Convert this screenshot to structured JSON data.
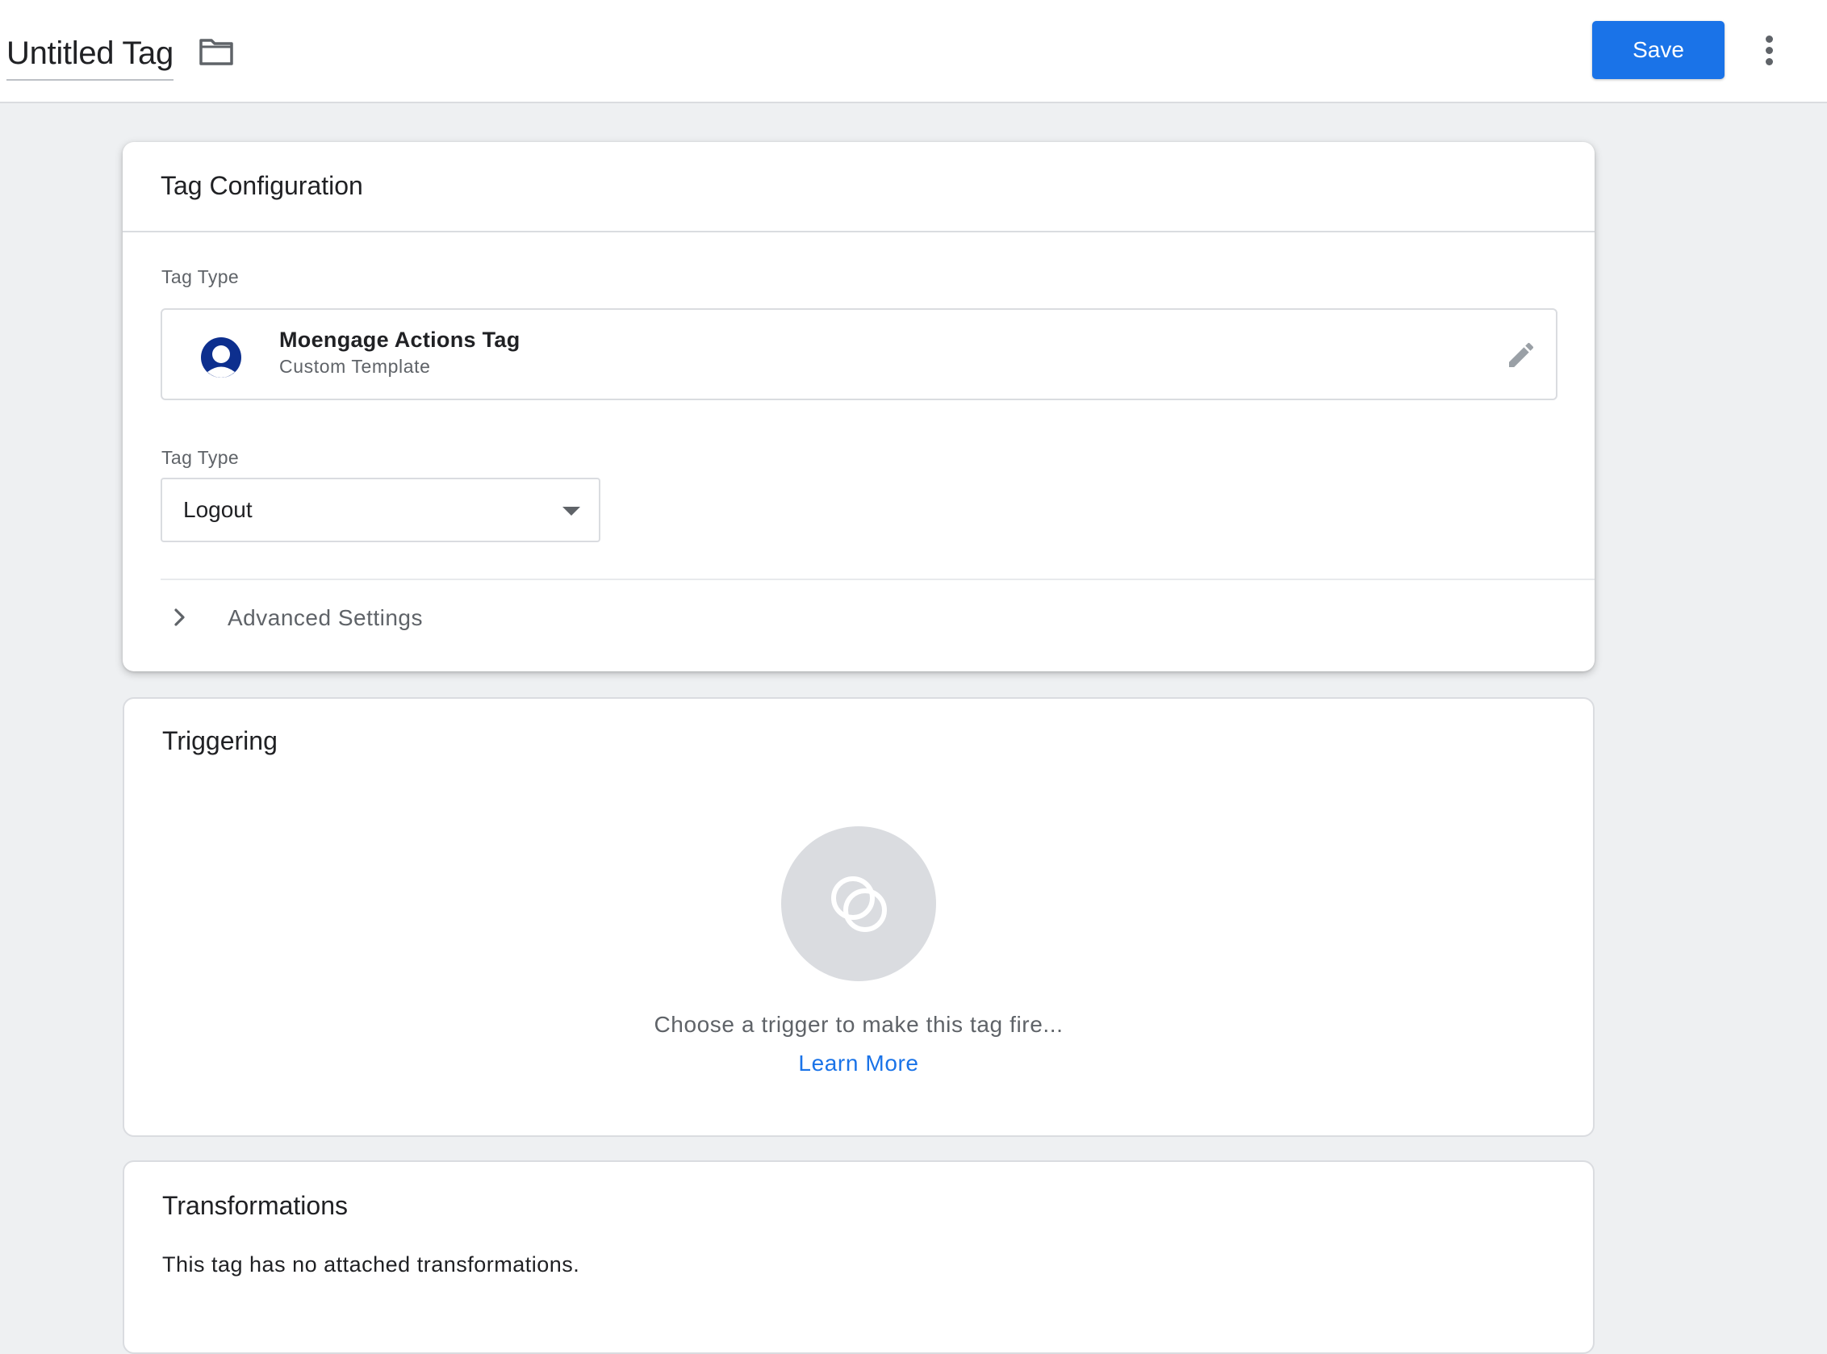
{
  "header": {
    "title": "Untitled Tag",
    "folder_icon": "folder-icon",
    "save_label": "Save",
    "more_icon": "more-vert-icon"
  },
  "tag_configuration": {
    "title": "Tag Configuration",
    "tag_type_label": "Tag Type",
    "template": {
      "icon": "moengage-logo-icon",
      "name": "Moengage Actions Tag",
      "subtitle": "Custom Template",
      "edit_icon": "pencil-icon"
    },
    "action_type_label": "Tag Type",
    "action_type_value": "Logout",
    "advanced_settings_label": "Advanced Settings"
  },
  "triggering": {
    "title": "Triggering",
    "empty_text": "Choose a trigger to make this tag fire...",
    "learn_more": "Learn More"
  },
  "transformations": {
    "title": "Transformations",
    "empty_text": "This tag has no attached transformations."
  },
  "colors": {
    "accent": "#1a73e8",
    "background": "#eef0f2",
    "moengage_brand": "#0d2f8e"
  }
}
